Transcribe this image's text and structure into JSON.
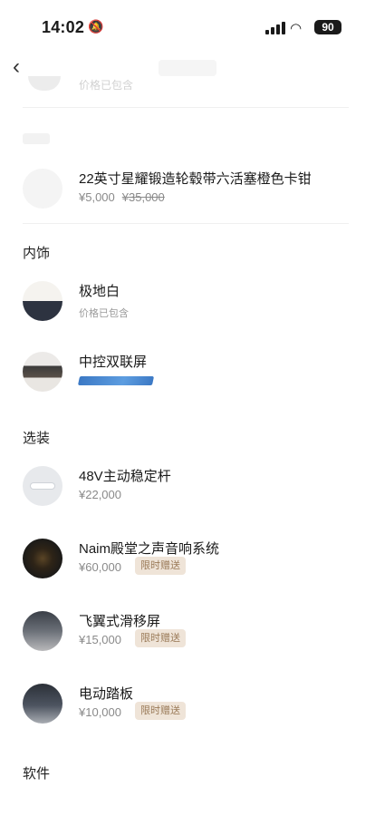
{
  "status_bar": {
    "time": "14:02",
    "battery": "90"
  },
  "top_partial": {
    "sub": "价格已包含"
  },
  "wheels": {
    "name": "22英寸星耀锻造轮毂带六活塞橙色卡钳",
    "price": "¥5,000",
    "original_price": "¥35,000"
  },
  "sections": {
    "interior": "内饰",
    "options": "选装",
    "software": "软件"
  },
  "interior_items": [
    {
      "name": "极地白",
      "sub": "价格已包含"
    },
    {
      "name": "中控双联屏"
    }
  ],
  "option_items": [
    {
      "name": "48V主动稳定杆",
      "price": "¥22,000"
    },
    {
      "name": "Naim殿堂之声音响系统",
      "price": "¥60,000",
      "badge": "限时赠送"
    },
    {
      "name": "飞翼式滑移屏",
      "price": "¥15,000",
      "badge": "限时赠送"
    },
    {
      "name": "电动踏板",
      "price": "¥10,000",
      "badge": "限时赠送"
    }
  ],
  "icons": {
    "back": "chevron-left-icon",
    "mute": "bell-slash-icon",
    "signal": "cellular-signal-icon",
    "wifi": "wifi-icon"
  }
}
